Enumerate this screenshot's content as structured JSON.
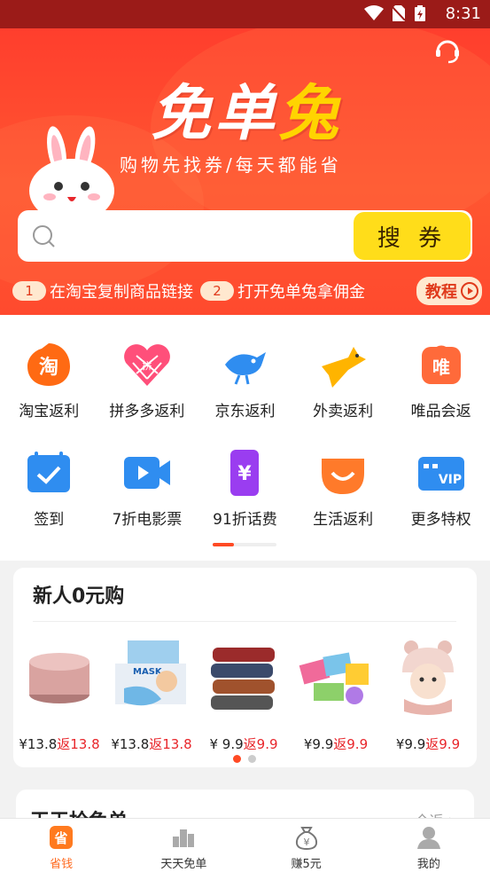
{
  "status_bar": {
    "time": "8:31"
  },
  "header": {
    "logo_text_a": "免单",
    "logo_text_b": "兔",
    "slogan": "购物先找券/每天都能省",
    "search_placeholder": "",
    "search_button": "搜 券",
    "step1_num": "1",
    "step1_text": "在淘宝复制商品链接",
    "step2_num": "2",
    "step2_text": "打开免单兔拿佣金",
    "tutorial_label": "教程"
  },
  "categories": {
    "row1": [
      {
        "label": "淘宝返利",
        "icon": "taobao-icon"
      },
      {
        "label": "拼多多返利",
        "icon": "pinduoduo-icon"
      },
      {
        "label": "京东返利",
        "icon": "jd-icon"
      },
      {
        "label": "外卖返利",
        "icon": "takeout-icon"
      },
      {
        "label": "唯品会返",
        "icon": "vipshop-icon"
      }
    ],
    "row2": [
      {
        "label": "签到",
        "icon": "checkin-icon"
      },
      {
        "label": "7折电影票",
        "icon": "movie-icon"
      },
      {
        "label": "91折话费",
        "icon": "phone-bill-icon"
      },
      {
        "label": "生活返利",
        "icon": "life-icon"
      },
      {
        "label": "更多特权",
        "icon": "vip-card-icon"
      }
    ]
  },
  "newuser": {
    "title": "新人0元购",
    "products": [
      {
        "price": "¥13.8",
        "return": "返13.8"
      },
      {
        "price": "¥13.8",
        "return": "返13.8"
      },
      {
        "price": "¥ 9.9",
        "return": "返9.9"
      },
      {
        "price": "¥9.9",
        "return": "返9.9"
      },
      {
        "price": "¥9.9",
        "return": "返9.9"
      }
    ]
  },
  "daily": {
    "title": "天天抢免单",
    "more": "全返 >"
  },
  "bottom_nav": [
    {
      "label": "省钱",
      "icon": "save-money-icon"
    },
    {
      "label": "天天免单",
      "icon": "daily-free-icon"
    },
    {
      "label": "赚5元",
      "icon": "earn-money-bag-icon"
    },
    {
      "label": "我的",
      "icon": "profile-icon"
    }
  ],
  "colors": {
    "brand_red": "#ff4a2e",
    "search_yellow": "#ffdd1a",
    "accent_orange": "#ff6a1f"
  }
}
